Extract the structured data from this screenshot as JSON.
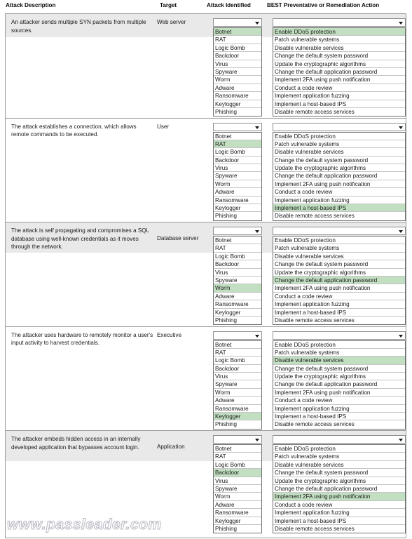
{
  "header": {
    "col_description": "Attack Description",
    "col_target": "Target",
    "col_attack": "Attack Identified",
    "col_best": "BEST Preventative or Remediation Action"
  },
  "colors": {
    "selection_highlight": "#c2dfc2",
    "row_shade": "#e9e9e9",
    "border": "#9a9a9a",
    "text": "#1a1a1a"
  },
  "attack_options": [
    "Botnet",
    "RAT",
    "Logic Bomb",
    "Backdoor",
    "Virus",
    "Spyware",
    "Worm",
    "Adware",
    "Ransomware",
    "Keylogger",
    "Phishing"
  ],
  "action_options": [
    "Enable DDoS protection",
    "Patch vulnerable systems",
    "Disable vulnerable services",
    "Change the default system password",
    "Update the cryptographic algorithms",
    "Change the default application password",
    "Implement 2FA using push notification",
    "Conduct a code review",
    "Implement application fuzzing",
    "Implement a host-based IPS",
    "Disable remote access services"
  ],
  "rows": [
    {
      "description": "An attacker sends multiple SYN packets from multiple sources.",
      "target": "Web server",
      "selected_attack": "Botnet",
      "selected_action": "Enable DDoS protection"
    },
    {
      "description": "The attack establishes a connection, which allows remote commands to be executed.",
      "target": "User",
      "selected_attack": "RAT",
      "selected_action": "Implement a host-based IPS"
    },
    {
      "description": "The attack is self propagating and compromises a SQL database using well-known credentials as it moves through the network.",
      "target": "Database server",
      "selected_attack": "Worm",
      "selected_action": "Change the default application password"
    },
    {
      "description": "The attacker uses hardware to remotely monitor a user's input activity to harvest credentials.",
      "target": "Executive",
      "selected_attack": "Keylogger",
      "selected_action": "Disable vulnerable services"
    },
    {
      "description": "The attacker embeds hidden access in an internally developed application that bypasses account login.",
      "target": "Application",
      "selected_attack": "Backdoor",
      "selected_action": "Implement 2FA using push notification"
    }
  ],
  "watermark": "www.passleader.com"
}
